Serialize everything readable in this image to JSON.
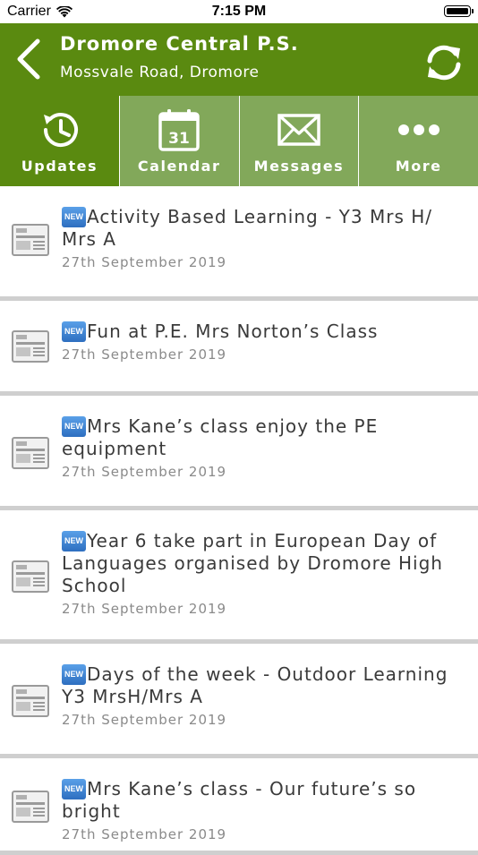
{
  "status_bar": {
    "carrier": "Carrier",
    "time": "7:15 PM"
  },
  "header": {
    "title": "Dromore Central P.S.",
    "subtitle": "Mossvale Road, Dromore",
    "back_icon": "chevron-left-icon",
    "refresh_icon": "refresh-icon",
    "background_color": "#5a8a10"
  },
  "tabs": [
    {
      "label": "Updates",
      "icon": "clock-history-icon",
      "active": true
    },
    {
      "label": "Calendar",
      "icon": "calendar-icon",
      "badge": "31",
      "active": false
    },
    {
      "label": "Messages",
      "icon": "envelope-icon",
      "active": false
    },
    {
      "label": "More",
      "icon": "ellipsis-icon",
      "active": false
    }
  ],
  "news": [
    {
      "badge": "NEW",
      "title": "Activity Based Learning - Y3 Mrs H/ Mrs A",
      "date": "27th September 2019"
    },
    {
      "badge": "NEW",
      "title": "Fun at P.E. Mrs Norton’s Class",
      "date": "27th September 2019"
    },
    {
      "badge": "NEW",
      "title": "Mrs Kane’s class enjoy the PE equipment",
      "date": "27th September 2019"
    },
    {
      "badge": "NEW",
      "title": "Year 6 take part in European Day of Languages organised by Dromore High School",
      "date": "27th September 2019"
    },
    {
      "badge": "NEW",
      "title": "Days of the week - Outdoor Learning Y3 MrsH/Mrs A",
      "date": "27th September 2019"
    },
    {
      "badge": "NEW",
      "title": "Mrs Kane’s class - Our future’s so bright",
      "date": "27th September 2019"
    }
  ]
}
